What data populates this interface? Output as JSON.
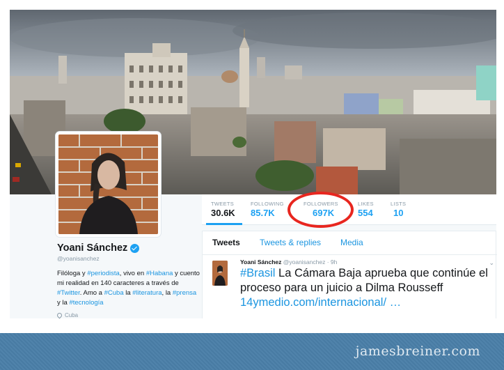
{
  "stats": [
    {
      "label": "TWEETS",
      "value": "30.6K"
    },
    {
      "label": "FOLLOWING",
      "value": "85.7K"
    },
    {
      "label": "FOLLOWERS",
      "value": "697K"
    },
    {
      "label": "LIKES",
      "value": "554"
    },
    {
      "label": "LISTS",
      "value": "10"
    }
  ],
  "profile": {
    "name": "Yoani Sánchez",
    "handle": "@yoanisanchez",
    "bio": {
      "p1": "Filóloga y ",
      "t1": "#periodista",
      "p2": ", vivo en ",
      "t2": "#Habana",
      "p3": " y cuento mi realidad en 140 caracteres a través de ",
      "t3": "#Twitter",
      "p4": ". Amo a ",
      "t4": "#Cuba",
      "p5": " la ",
      "t5": "#literatura",
      "p6": ", la ",
      "t6": "#prensa",
      "p7": " y la ",
      "t7": "#tecnología"
    },
    "location": "Cuba"
  },
  "tabs": [
    {
      "label": "Tweets"
    },
    {
      "label": "Tweets & replies"
    },
    {
      "label": "Media"
    }
  ],
  "tweet": {
    "name": "Yoani Sánchez",
    "handle": "@yoanisanchez",
    "time": "· 9h",
    "hashtag": "#Brasil",
    "text": " La Cámara Baja aprueba que continúe el proceso para un juicio a Dilma Rousseff ",
    "link": "14ymedio.com/internacional/ …"
  },
  "footer": {
    "watermark": "jamesbreiner.com"
  },
  "colors": {
    "link_blue": "#1da1f2",
    "highlight_red": "#e8261f",
    "footer_blue": "#4a7fa8"
  }
}
